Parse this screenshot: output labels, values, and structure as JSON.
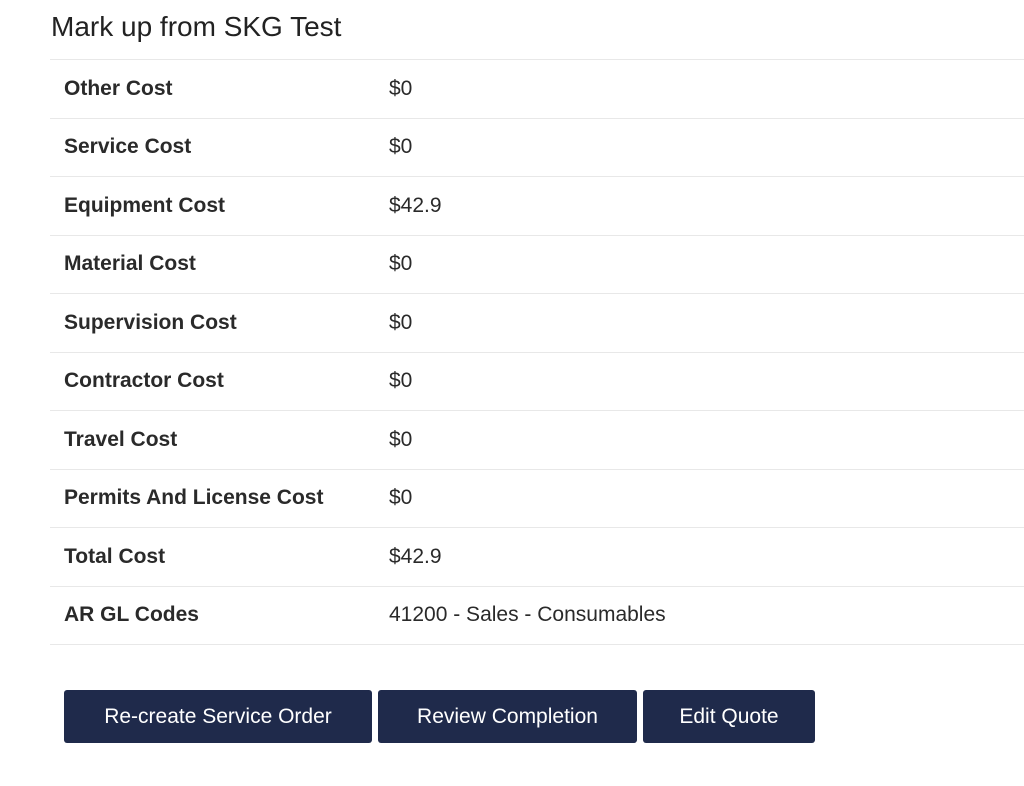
{
  "section": {
    "title": "Mark up from SKG Test"
  },
  "costs": [
    {
      "label": "Other Cost",
      "value": "$0"
    },
    {
      "label": "Service Cost",
      "value": "$0"
    },
    {
      "label": "Equipment Cost",
      "value": "$42.9"
    },
    {
      "label": "Material Cost",
      "value": "$0"
    },
    {
      "label": "Supervision Cost",
      "value": "$0"
    },
    {
      "label": "Contractor Cost",
      "value": "$0"
    },
    {
      "label": "Travel Cost",
      "value": "$0"
    },
    {
      "label": "Permits And License Cost",
      "value": "$0"
    },
    {
      "label": "Total Cost",
      "value": "$42.9"
    },
    {
      "label": "AR GL Codes",
      "value": "41200 - Sales - Consumables"
    }
  ],
  "actions": {
    "recreate_label": "Re-create Service Order",
    "review_label": "Review Completion",
    "edit_label": "Edit Quote"
  },
  "colors": {
    "button_bg": "#1f2a4b",
    "button_text": "#ffffff",
    "divider": "#e8e8e8"
  }
}
